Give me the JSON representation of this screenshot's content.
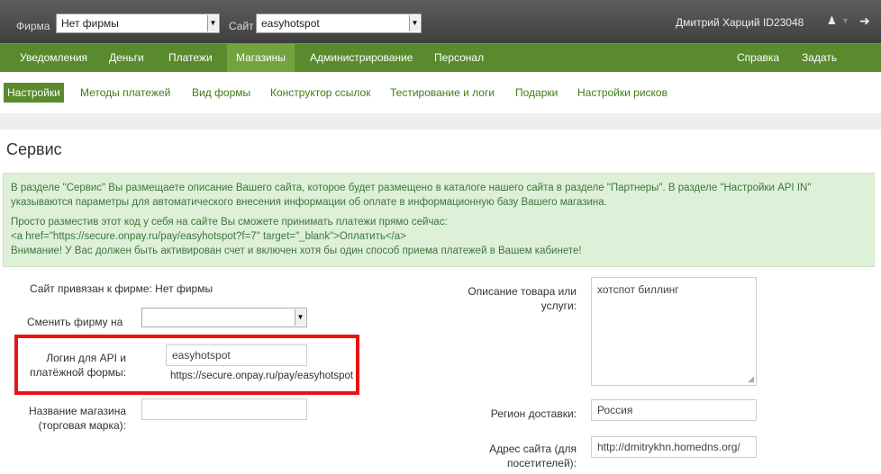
{
  "topbar": {
    "firm_label": "Фирма",
    "firm_value": "Нет фирмы",
    "site_label": "Сайт",
    "site_value": "easyhotspot",
    "user_name": "Дмитрий Харций ID23048",
    "user_icon": "user-icon",
    "logout_icon": "logout-icon"
  },
  "nav": [
    {
      "label": "Уведомления",
      "active": false
    },
    {
      "label": "Деньги",
      "active": false
    },
    {
      "label": "Платежи",
      "active": false
    },
    {
      "label": "Магазины",
      "active": true
    },
    {
      "label": "Администрирование",
      "active": false
    },
    {
      "label": "Персонал",
      "active": false
    },
    {
      "label": "Справка",
      "active": false
    },
    {
      "label": "Задать вопрос",
      "active": false
    }
  ],
  "subnav": [
    {
      "label": "Настройки",
      "active": true
    },
    {
      "label": "Методы платежей",
      "active": false
    },
    {
      "label": "Вид формы",
      "active": false
    },
    {
      "label": "Конструктор ссылок",
      "active": false
    },
    {
      "label": "Тестирование и логи",
      "active": false
    },
    {
      "label": "Подарки",
      "active": false
    },
    {
      "label": "Настройки рисков",
      "active": false
    }
  ],
  "page": {
    "title": "Сервис",
    "alert": {
      "line1": "В разделе \"Сервис\" Вы размещаете описание Вашего сайта, которое будет размещено в каталоге нашего сайта в разделе \"Партнеры\". В разделе \"Настройки API IN\" указываются параметры для автоматического внесения информации об оплате в информационную базу Вашего магазина.",
      "line2": "Просто разместив этот код у себя на сайте Вы сможете принимать платежи прямо сейчас:",
      "line3": "<a href=\"https://secure.onpay.ru/pay/easyhotspot?f=7\" target=\"_blank\">Оплатить</a>",
      "line4": "Внимание! У Вас должен быть активирован счет и включен хотя бы один способ приема платежей в Вашем кабинете!"
    }
  },
  "form": {
    "bound_firm": "Сайт привязан к фирме: Нет фирмы",
    "change_firm_label": "Сменить фирму на",
    "change_firm_value": "",
    "api_login_label_1": "Логин для API и",
    "api_login_label_2": "платёжной формы:",
    "api_login_value": "easyhotspot",
    "api_login_url": "https://secure.onpay.ru/pay/easyhotspot",
    "shop_name_label_1": "Название магазина",
    "shop_name_label_2": "(торговая марка):",
    "shop_name_value": "",
    "description_label_1": "Описание товара или",
    "description_label_2": "услуги:",
    "description_value": "хотспот биллинг",
    "region_label": "Регион доставки:",
    "region_value": "Россия",
    "site_url_label_1": "Адрес сайта (для",
    "site_url_label_2": "посетителей):",
    "site_url_value": "http://dmitrykhn.homedns.org/"
  },
  "colors": {
    "nav_bg": "#5a8a2e",
    "nav_active": "#73a33f",
    "alert_bg": "#dff0d8",
    "highlight": "#e11111"
  }
}
